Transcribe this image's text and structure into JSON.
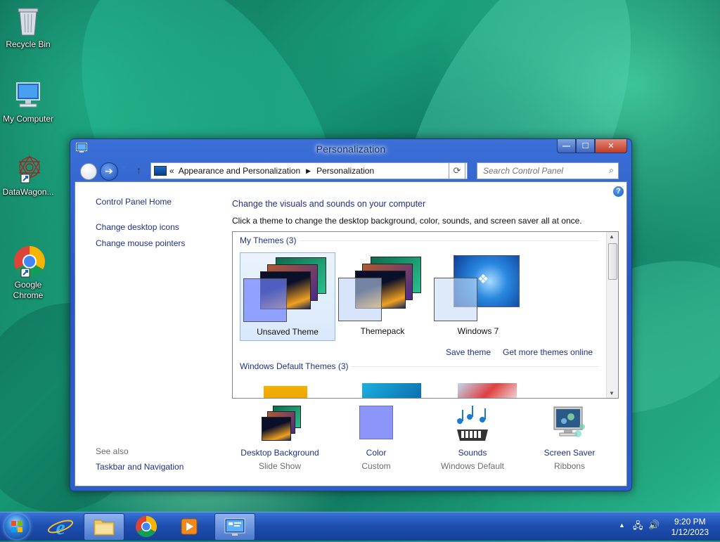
{
  "desktop": {
    "icons": [
      {
        "label": "Recycle Bin"
      },
      {
        "label": "My Computer"
      },
      {
        "label": "DataWagon..."
      },
      {
        "label": "Google\nChrome"
      }
    ]
  },
  "window": {
    "title": "Personalization",
    "caption": {
      "minimize": "—",
      "maximize": "☐",
      "close": "✕"
    },
    "address": {
      "chevron": "«",
      "crumbs": [
        "Appearance and Personalization",
        "Personalization"
      ]
    },
    "search_placeholder": "Search Control Panel",
    "help_glyph": "?"
  },
  "left_pane": {
    "home": "Control Panel Home",
    "links": [
      "Change desktop icons",
      "Change mouse pointers"
    ],
    "see_also_label": "See also",
    "see_also_links": [
      "Taskbar and Navigation"
    ]
  },
  "main": {
    "heading": "Change the visuals and sounds on your computer",
    "subheading": "Click a theme to change the desktop background, color, sounds, and screen saver all at once.",
    "my_themes_label": "My Themes (3)",
    "my_themes": [
      {
        "name": "Unsaved Theme",
        "selected": true
      },
      {
        "name": "Themepack",
        "selected": false
      },
      {
        "name": "Windows 7",
        "selected": false
      }
    ],
    "save_theme": "Save theme",
    "get_more": "Get more themes online",
    "default_themes_label": "Windows Default Themes (3)"
  },
  "bottom": [
    {
      "label": "Desktop Background",
      "sub": "Slide Show",
      "icon": "desktop-background-icon"
    },
    {
      "label": "Color",
      "sub": "Custom",
      "icon": "color-icon",
      "color": "#8c96fa"
    },
    {
      "label": "Sounds",
      "sub": "Windows Default",
      "icon": "sounds-icon"
    },
    {
      "label": "Screen Saver",
      "sub": "Ribbons",
      "icon": "screen-saver-icon"
    }
  ],
  "taskbar": {
    "time": "9:20 PM",
    "date": "1/12/2023"
  }
}
